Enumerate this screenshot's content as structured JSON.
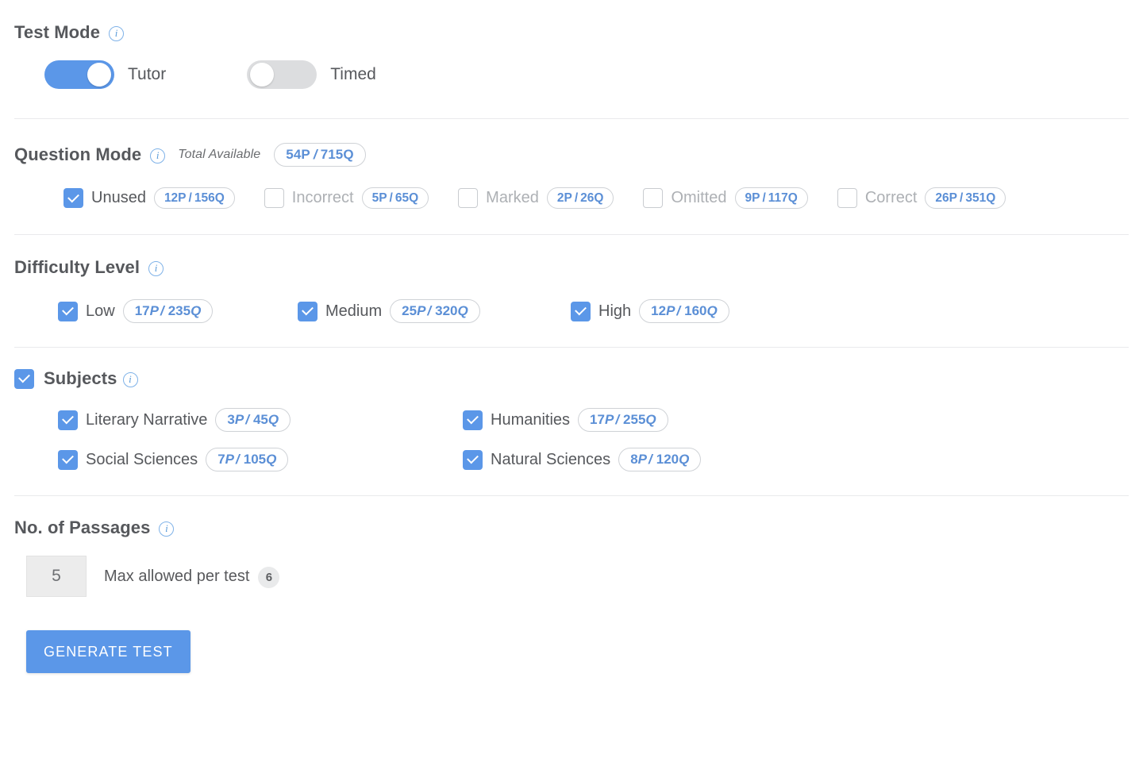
{
  "test_mode": {
    "title": "Test Mode",
    "info_icon": "info-icon",
    "toggles": [
      {
        "label": "Tutor",
        "state": "on"
      },
      {
        "label": "Timed",
        "state": "off"
      }
    ]
  },
  "question_mode": {
    "title": "Question Mode",
    "info_icon": "info-icon",
    "total_available_label": "Total Available",
    "total_available_p": "54P",
    "total_available_sep": "/",
    "total_available_q": "715Q",
    "options": [
      {
        "label": "Unused",
        "checked": true,
        "p": "12P",
        "sep": "/",
        "q": "156Q"
      },
      {
        "label": "Incorrect",
        "checked": false,
        "p": "5P",
        "sep": "/",
        "q": "65Q"
      },
      {
        "label": "Marked",
        "checked": false,
        "p": "2P",
        "sep": "/",
        "q": "26Q"
      },
      {
        "label": "Omitted",
        "checked": false,
        "p": "9P",
        "sep": "/",
        "q": "117Q"
      },
      {
        "label": "Correct",
        "checked": false,
        "p": "26P",
        "sep": "/",
        "q": "351Q"
      }
    ]
  },
  "difficulty": {
    "title": "Difficulty Level",
    "info_icon": "info-icon",
    "options": [
      {
        "label": "Low",
        "checked": true,
        "num1": "17",
        "u1": "P",
        "sep": "/",
        "num2": "235",
        "u2": "Q"
      },
      {
        "label": "Medium",
        "checked": true,
        "num1": "25",
        "u1": "P",
        "sep": "/",
        "num2": "320",
        "u2": "Q"
      },
      {
        "label": "High",
        "checked": true,
        "num1": "12",
        "u1": "P",
        "sep": "/",
        "num2": "160",
        "u2": "Q"
      }
    ]
  },
  "subjects": {
    "title": "Subjects",
    "info_icon": "info-icon",
    "checked": true,
    "options": [
      {
        "label": "Literary Narrative",
        "checked": true,
        "num1": "3",
        "u1": "P",
        "sep": "/",
        "num2": "45",
        "u2": "Q"
      },
      {
        "label": "Humanities",
        "checked": true,
        "num1": "17",
        "u1": "P",
        "sep": "/",
        "num2": "255",
        "u2": "Q"
      },
      {
        "label": "Social Sciences",
        "checked": true,
        "num1": "7",
        "u1": "P",
        "sep": "/",
        "num2": "105",
        "u2": "Q"
      },
      {
        "label": "Natural Sciences",
        "checked": true,
        "num1": "8",
        "u1": "P",
        "sep": "/",
        "num2": "120",
        "u2": "Q"
      }
    ]
  },
  "passages": {
    "title": "No. of Passages",
    "info_icon": "info-icon",
    "value": "5",
    "max_label": "Max allowed per test",
    "max_value": "6"
  },
  "actions": {
    "generate_label": "GENERATE TEST"
  },
  "colors": {
    "accent": "#5b97e8",
    "pill_text": "#5b8fd6",
    "heading": "#56585c",
    "disabled": "#adb0b4",
    "divider": "#e9eaec"
  }
}
